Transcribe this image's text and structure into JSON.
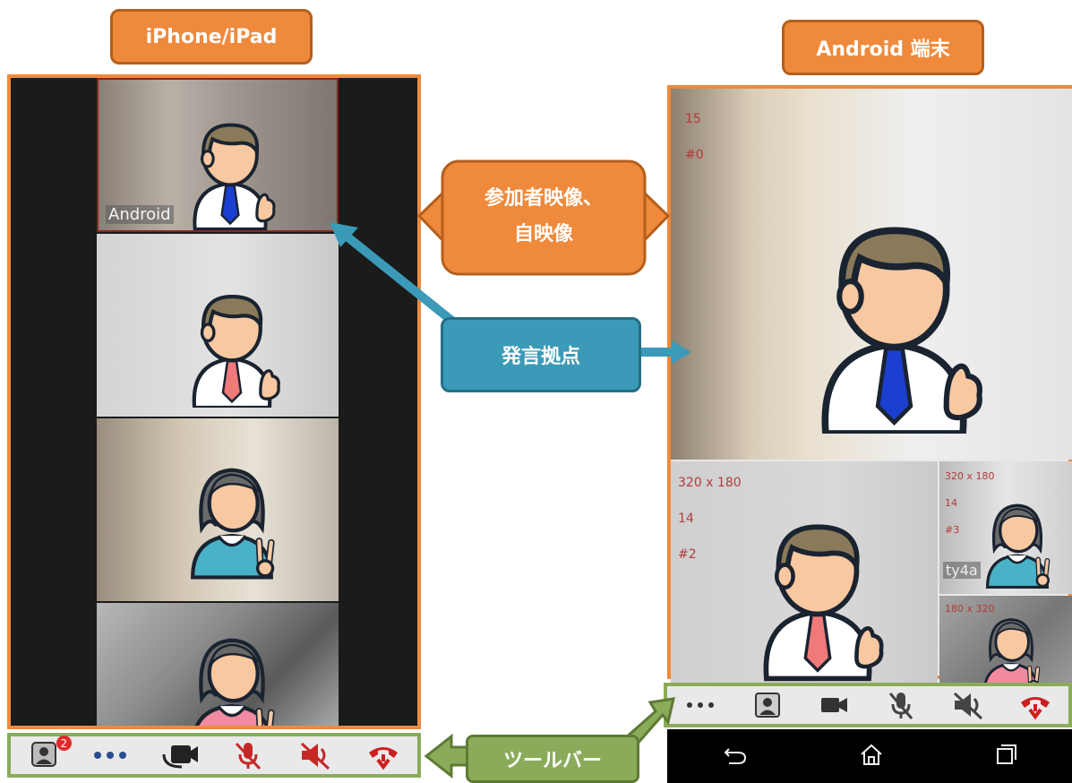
{
  "labels": {
    "iphone": "iPhone/iPad",
    "android": "Android 端末",
    "participant_video_line1": "参加者映像、",
    "participant_video_line2": "自映像",
    "speaker": "発言拠点",
    "toolbar": "ツールバー"
  },
  "iphone": {
    "tile1_name": "Android",
    "badge_count": "2"
  },
  "android": {
    "main_info": [
      "15",
      "#0"
    ],
    "tile_a_info": [
      "320 x 180",
      "14",
      "#2"
    ],
    "tile_b_info": [
      "320 x 180",
      "14",
      "#3"
    ],
    "tile_b_name": "ty4a",
    "tile_c_info": "180 x 320"
  },
  "colors": {
    "orange": "#ef8a3c",
    "teal": "#3a9ab8",
    "green": "#8aac5a",
    "hangup": "#cc1f1f"
  },
  "icons": {
    "iphone_toolbar": [
      "participants-icon",
      "more-icon",
      "camera-switch-icon",
      "mic-muted-icon",
      "speaker-muted-icon",
      "hangup-icon"
    ],
    "android_toolbar": [
      "more-icon",
      "participants-icon",
      "camera-icon",
      "mic-muted-icon",
      "speaker-muted-icon",
      "hangup-icon"
    ],
    "android_nav": [
      "back-icon",
      "home-icon",
      "recents-icon"
    ]
  }
}
